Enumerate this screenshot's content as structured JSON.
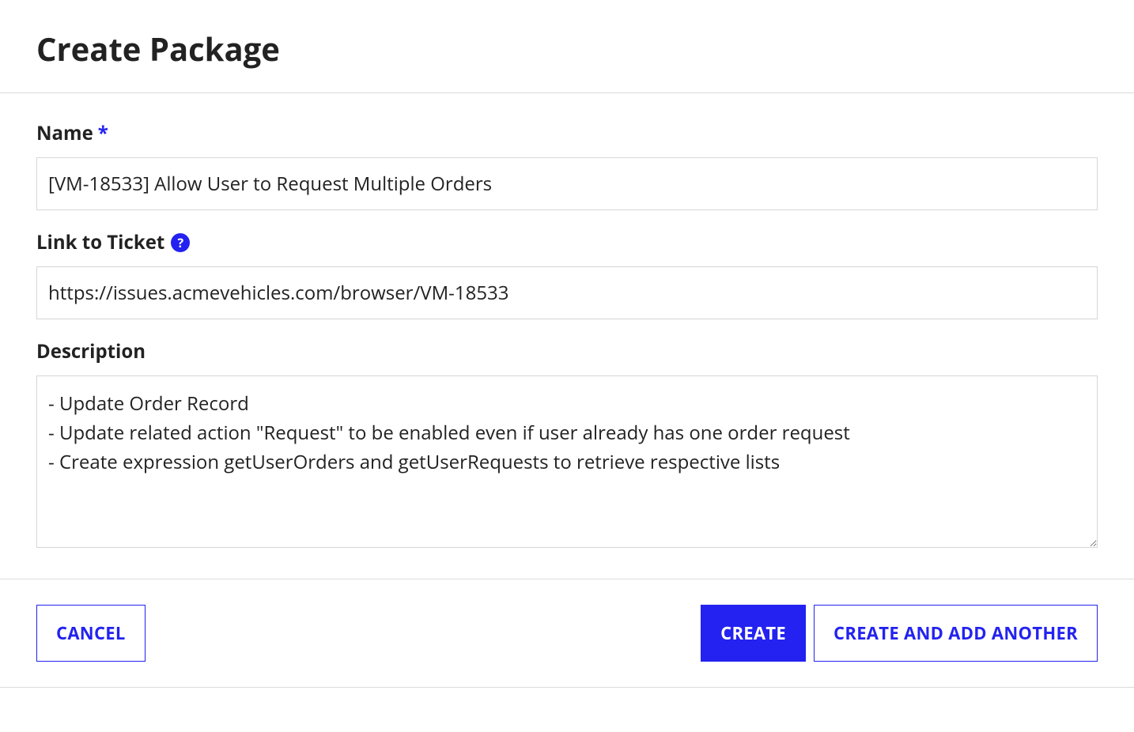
{
  "page": {
    "title": "Create Package"
  },
  "form": {
    "name": {
      "label": "Name",
      "required_marker": "*",
      "value": "[VM-18533] Allow User to Request Multiple Orders"
    },
    "ticket_link": {
      "label": "Link to Ticket",
      "value": "https://issues.acmevehicles.com/browser/VM-18533",
      "help_glyph": "?"
    },
    "description": {
      "label": "Description",
      "value": "- Update Order Record\n- Update related action \"Request\" to be enabled even if user already has one order request\n- Create expression getUserOrders and getUserRequests to retrieve respective lists"
    }
  },
  "buttons": {
    "cancel": "CANCEL",
    "create": "CREATE",
    "create_add_another": "CREATE AND ADD ANOTHER"
  }
}
